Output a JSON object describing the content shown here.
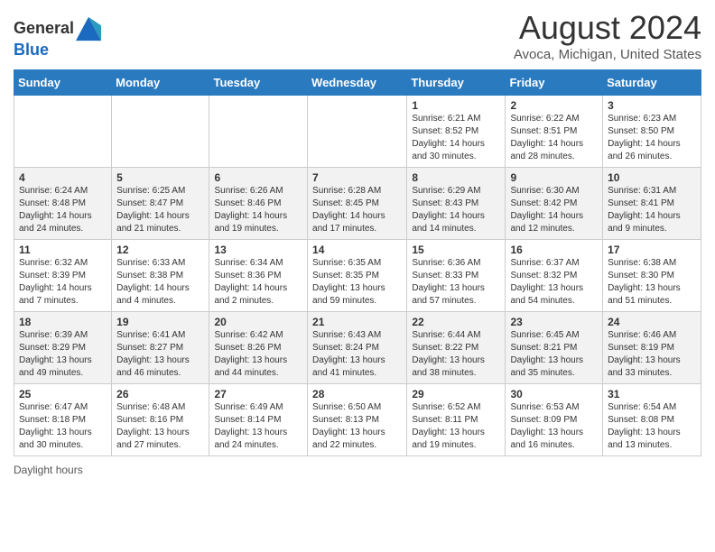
{
  "header": {
    "logo": {
      "line1": "General",
      "line2": "Blue"
    },
    "title": "August 2024",
    "location": "Avoca, Michigan, United States"
  },
  "calendar": {
    "days_of_week": [
      "Sunday",
      "Monday",
      "Tuesday",
      "Wednesday",
      "Thursday",
      "Friday",
      "Saturday"
    ],
    "weeks": [
      [
        {
          "day": "",
          "content": ""
        },
        {
          "day": "",
          "content": ""
        },
        {
          "day": "",
          "content": ""
        },
        {
          "day": "",
          "content": ""
        },
        {
          "day": "1",
          "content": "Sunrise: 6:21 AM\nSunset: 8:52 PM\nDaylight: 14 hours and 30 minutes."
        },
        {
          "day": "2",
          "content": "Sunrise: 6:22 AM\nSunset: 8:51 PM\nDaylight: 14 hours and 28 minutes."
        },
        {
          "day": "3",
          "content": "Sunrise: 6:23 AM\nSunset: 8:50 PM\nDaylight: 14 hours and 26 minutes."
        }
      ],
      [
        {
          "day": "4",
          "content": "Sunrise: 6:24 AM\nSunset: 8:48 PM\nDaylight: 14 hours and 24 minutes."
        },
        {
          "day": "5",
          "content": "Sunrise: 6:25 AM\nSunset: 8:47 PM\nDaylight: 14 hours and 21 minutes."
        },
        {
          "day": "6",
          "content": "Sunrise: 6:26 AM\nSunset: 8:46 PM\nDaylight: 14 hours and 19 minutes."
        },
        {
          "day": "7",
          "content": "Sunrise: 6:28 AM\nSunset: 8:45 PM\nDaylight: 14 hours and 17 minutes."
        },
        {
          "day": "8",
          "content": "Sunrise: 6:29 AM\nSunset: 8:43 PM\nDaylight: 14 hours and 14 minutes."
        },
        {
          "day": "9",
          "content": "Sunrise: 6:30 AM\nSunset: 8:42 PM\nDaylight: 14 hours and 12 minutes."
        },
        {
          "day": "10",
          "content": "Sunrise: 6:31 AM\nSunset: 8:41 PM\nDaylight: 14 hours and 9 minutes."
        }
      ],
      [
        {
          "day": "11",
          "content": "Sunrise: 6:32 AM\nSunset: 8:39 PM\nDaylight: 14 hours and 7 minutes."
        },
        {
          "day": "12",
          "content": "Sunrise: 6:33 AM\nSunset: 8:38 PM\nDaylight: 14 hours and 4 minutes."
        },
        {
          "day": "13",
          "content": "Sunrise: 6:34 AM\nSunset: 8:36 PM\nDaylight: 14 hours and 2 minutes."
        },
        {
          "day": "14",
          "content": "Sunrise: 6:35 AM\nSunset: 8:35 PM\nDaylight: 13 hours and 59 minutes."
        },
        {
          "day": "15",
          "content": "Sunrise: 6:36 AM\nSunset: 8:33 PM\nDaylight: 13 hours and 57 minutes."
        },
        {
          "day": "16",
          "content": "Sunrise: 6:37 AM\nSunset: 8:32 PM\nDaylight: 13 hours and 54 minutes."
        },
        {
          "day": "17",
          "content": "Sunrise: 6:38 AM\nSunset: 8:30 PM\nDaylight: 13 hours and 51 minutes."
        }
      ],
      [
        {
          "day": "18",
          "content": "Sunrise: 6:39 AM\nSunset: 8:29 PM\nDaylight: 13 hours and 49 minutes."
        },
        {
          "day": "19",
          "content": "Sunrise: 6:41 AM\nSunset: 8:27 PM\nDaylight: 13 hours and 46 minutes."
        },
        {
          "day": "20",
          "content": "Sunrise: 6:42 AM\nSunset: 8:26 PM\nDaylight: 13 hours and 44 minutes."
        },
        {
          "day": "21",
          "content": "Sunrise: 6:43 AM\nSunset: 8:24 PM\nDaylight: 13 hours and 41 minutes."
        },
        {
          "day": "22",
          "content": "Sunrise: 6:44 AM\nSunset: 8:22 PM\nDaylight: 13 hours and 38 minutes."
        },
        {
          "day": "23",
          "content": "Sunrise: 6:45 AM\nSunset: 8:21 PM\nDaylight: 13 hours and 35 minutes."
        },
        {
          "day": "24",
          "content": "Sunrise: 6:46 AM\nSunset: 8:19 PM\nDaylight: 13 hours and 33 minutes."
        }
      ],
      [
        {
          "day": "25",
          "content": "Sunrise: 6:47 AM\nSunset: 8:18 PM\nDaylight: 13 hours and 30 minutes."
        },
        {
          "day": "26",
          "content": "Sunrise: 6:48 AM\nSunset: 8:16 PM\nDaylight: 13 hours and 27 minutes."
        },
        {
          "day": "27",
          "content": "Sunrise: 6:49 AM\nSunset: 8:14 PM\nDaylight: 13 hours and 24 minutes."
        },
        {
          "day": "28",
          "content": "Sunrise: 6:50 AM\nSunset: 8:13 PM\nDaylight: 13 hours and 22 minutes."
        },
        {
          "day": "29",
          "content": "Sunrise: 6:52 AM\nSunset: 8:11 PM\nDaylight: 13 hours and 19 minutes."
        },
        {
          "day": "30",
          "content": "Sunrise: 6:53 AM\nSunset: 8:09 PM\nDaylight: 13 hours and 16 minutes."
        },
        {
          "day": "31",
          "content": "Sunrise: 6:54 AM\nSunset: 8:08 PM\nDaylight: 13 hours and 13 minutes."
        }
      ]
    ]
  },
  "footer": {
    "label": "Daylight hours"
  }
}
